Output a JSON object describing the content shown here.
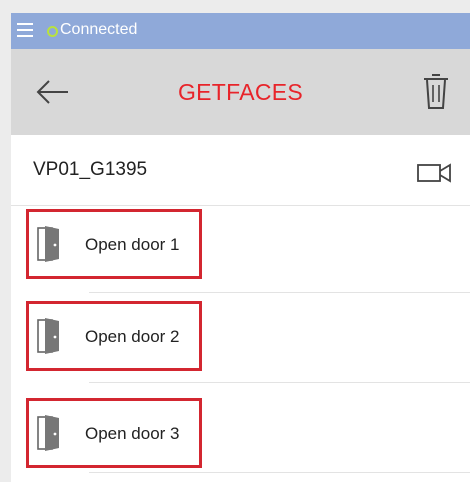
{
  "status_bar": {
    "connection_text": "Connected",
    "connection_color": "#b9e23e",
    "background_color": "#8fa9d9"
  },
  "toolbar": {
    "title": "GETFACES",
    "title_color": "#e8242a",
    "back_icon": "arrow-left-icon",
    "delete_icon": "trash-icon"
  },
  "device": {
    "name": "VP01_G1395",
    "action_icon": "video-camera-icon"
  },
  "door_actions": [
    {
      "label": "Open door 1",
      "icon": "door-icon"
    },
    {
      "label": "Open door 2",
      "icon": "door-icon"
    },
    {
      "label": "Open door 3",
      "icon": "door-icon"
    }
  ],
  "highlight_color": "#d32630"
}
